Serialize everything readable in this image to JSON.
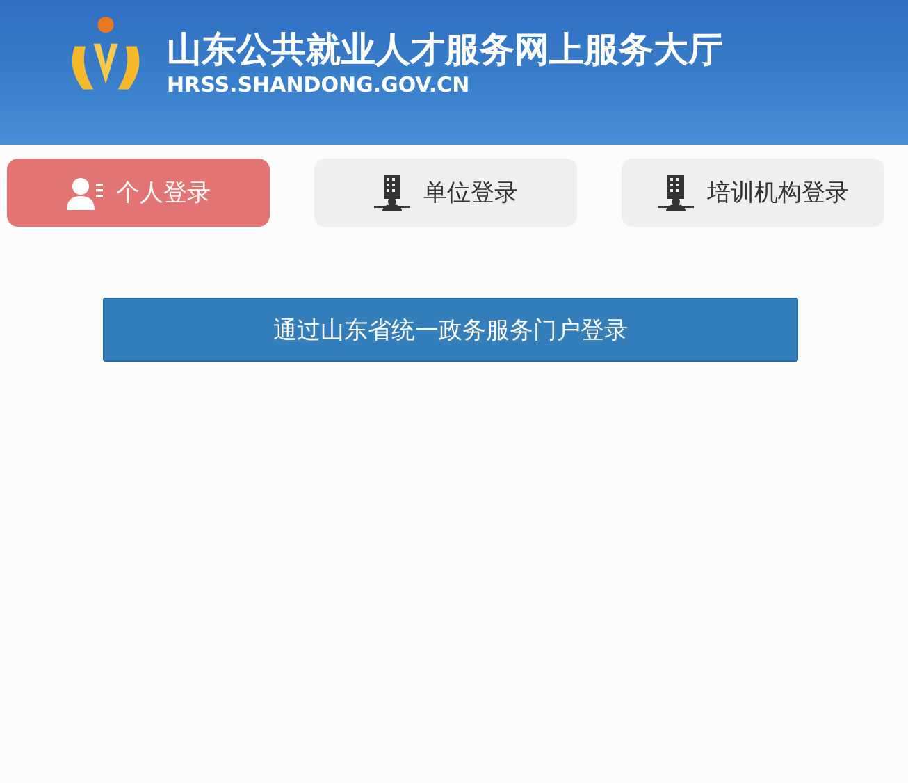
{
  "header": {
    "title": "山东公共就业人才服务网上服务大厅",
    "subtitle": "HRSS.SHANDONG.GOV.CN"
  },
  "tabs": [
    {
      "label": "个人登录",
      "kind": "person",
      "selected": true
    },
    {
      "label": "单位登录",
      "kind": "building",
      "selected": false
    },
    {
      "label": "培训机构登录",
      "kind": "building",
      "selected": false
    }
  ],
  "login_button": "通过山东省统一政务服务门户登录"
}
